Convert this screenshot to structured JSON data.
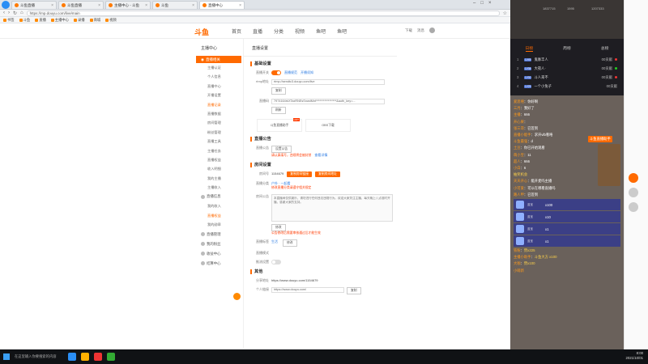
{
  "browser": {
    "tabs": [
      {
        "label": "斗鱼直播",
        "active": false
      },
      {
        "label": "斗鱼直播",
        "active": false
      },
      {
        "label": "主播中心 - 斗鱼",
        "active": false
      },
      {
        "label": "斗鱼",
        "active": false
      },
      {
        "label": "直播中心",
        "active": true
      }
    ],
    "url": "https://mp.douyu.com/live/main",
    "bookmarks": [
      "书签",
      "斗鱼",
      "直播",
      "主播中心",
      "录播",
      "商城",
      "视频"
    ]
  },
  "site": {
    "brand": "斗鱼",
    "nav": [
      "首页",
      "直播",
      "分类",
      "视频",
      "鱼吧",
      "鱼吧"
    ],
    "header_right": [
      "下载",
      "消息"
    ]
  },
  "sidebar": {
    "title": "主播中心",
    "active_group": "直播相关",
    "items": [
      "直播相关",
      "主播认证",
      "个人信息",
      "直播中心",
      "开播设置",
      "直播记录",
      "直播数据",
      "房间管理",
      "粉丝管理",
      "直播工具",
      "主播任务",
      "直播权益",
      "收入明细",
      "我的主播",
      "主播收入"
    ],
    "highlight_index": 5,
    "groups": [
      "直播信息",
      "直播管理",
      "我的粉丝",
      "收益中心",
      "结算中心"
    ],
    "extra_items": [
      "我的收入",
      "直播权益",
      "我的勋章"
    ]
  },
  "content": {
    "page_title": "直播设置",
    "section_basic": "基础设置",
    "live_label": "直播开关",
    "live_link": "直播规范",
    "live_link2": "开播须知",
    "rtmp_label": "rtmp地址",
    "rtmp_value": "rtmp://sendtc3.douyu.com/live",
    "copy_btn": "复制",
    "key_label": "直播码",
    "key_value": "7974164rkXTaxRNEsSnwdMnt*****************&auth_key=...",
    "reset_btn": "刷新",
    "card1": "斗鱼直播助手",
    "card1_hot": "HOT",
    "card2": "OBS下载",
    "section_notice": "直播公告",
    "notice_label": "直播公告",
    "notice_btn": "设置公告",
    "notice_warn": "请认真填写，违规将会被封禁",
    "notice_link": "查看详情",
    "section_room": "房间设置",
    "room_label": "房间号",
    "room_value": "1154679",
    "room_btn1": "复制房间链接",
    "room_btn2": "复制房间地址",
    "cate_label": "直播分类",
    "cate_value": "户外 · 一起看",
    "cate_warn": "修改直播分类请遵守相关规定",
    "desc_label": "房间公告",
    "desc_text": "本直播间仅供娱乐，请勿进行任何违法违规行为。欢迎大家关注主播，每天晚上八点准时开播，感谢大家的支持。",
    "desc_btn": "修改",
    "desc_warn": "公告修改后需要审核通过后才能生效",
    "tag_label": "直播标签",
    "tag_value": "生活",
    "tag_btn": "修改",
    "mode_label": "直播模式",
    "mode2_label": "推流设置",
    "section_other": "其他",
    "share_label": "分享地址",
    "share_value": "https://www.douyu.com/1154679",
    "link_label": "个人链接",
    "link_value": "https://www.douyu.com/",
    "link_btn": "复制"
  },
  "panel": {
    "top_stats": [
      "1837715",
      "1595",
      "1207333"
    ],
    "rank_tabs": [
      "日榜",
      "周榜",
      "总榜"
    ],
    "ranks": [
      {
        "num": "1",
        "lv": "LV45",
        "name": "鬼脉丰人",
        "pts": "00贡献"
      },
      {
        "num": "2",
        "lv": "LV38",
        "name": "大夜人·",
        "pts": "00贡献"
      },
      {
        "num": "3",
        "lv": "LV30",
        "name": "斗人来不",
        "pts": "00贡献"
      },
      {
        "num": "4",
        "lv": "LV25",
        "name": "一个小兔子",
        "pts": "00贡献"
      }
    ],
    "chat": [
      {
        "user": "爱思嘻",
        "text": "你好啊"
      },
      {
        "user": "三月",
        "text": "我好了"
      },
      {
        "user": "主播",
        "text": "666"
      },
      {
        "user": "开心果",
        "text": ""
      },
      {
        "user": "张三哥",
        "text": "已签到"
      },
      {
        "user": "直播小能手",
        "text": "求开vlb看咯"
      },
      {
        "user": "斗鱼最强",
        "text": "d"
      },
      {
        "user": "土豆",
        "text": "你已开始观看"
      },
      {
        "user": "萌小宝",
        "text": "11"
      },
      {
        "user": "超人",
        "text": "666"
      },
      {
        "user": "小白",
        "text": "6"
      },
      {
        "user": "",
        "text": "抽奖机会"
      },
      {
        "user": "天天开心",
        "text": "能开麦吗主播"
      },
      {
        "user": "小可爱",
        "text": "可以在哪看直播吗"
      },
      {
        "user": "路人甲",
        "text": "已签到"
      }
    ],
    "gifts": [
      {
        "name": "蓝宝",
        "count": "x100"
      },
      {
        "name": "蓝宝",
        "count": "x10"
      },
      {
        "name": "蓝宝",
        "count": "x1"
      },
      {
        "name": "蓝宝",
        "count": "x1"
      }
    ],
    "tail": [
      {
        "user": "铁粉",
        "text": "赞x225"
      },
      {
        "user": "主播小助手",
        "text": "斗鱼大方 x100"
      },
      {
        "user": "大咖",
        "text": "赞x100"
      },
      {
        "user": "小萌新",
        "text": ""
      }
    ],
    "badge": "斗鱼直播助手"
  },
  "taskbar": {
    "search": "在这里输入你要搜索的内容",
    "time": "8:00",
    "date": "2021/10/01"
  },
  "colors": {
    "accent": "#ff6a00",
    "panel_bg": "#6a615b"
  }
}
